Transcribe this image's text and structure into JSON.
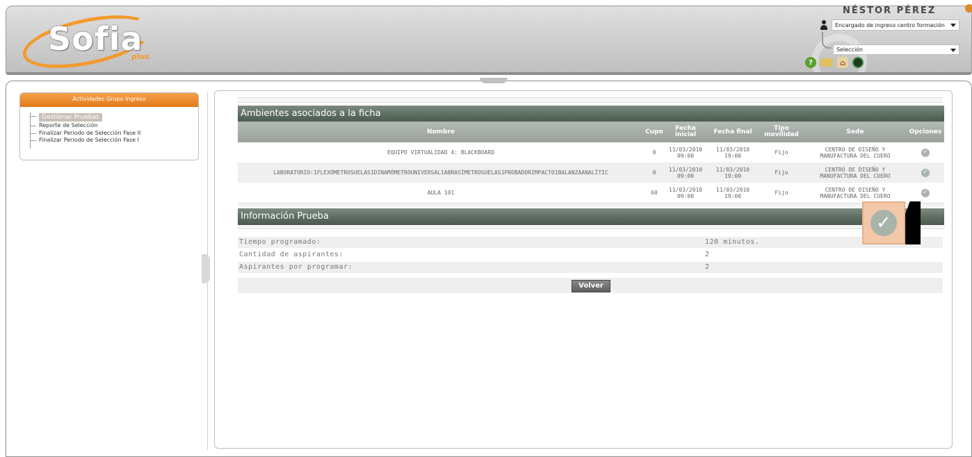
{
  "header": {
    "logo_text": "Sofia",
    "logo_sub": "plus",
    "user_name": "NÉSTOR PÉREZ",
    "role_value": "Encargado de ingreso centro formación",
    "selection_value": "Selección"
  },
  "sidebar": {
    "title": "Actividades Grupo Ingreso",
    "items": [
      {
        "label": "Gestionar Pruebas",
        "active": true
      },
      {
        "label": "Reporte de Selección"
      },
      {
        "label": "Finalizar Periodo de Selección Fase II"
      },
      {
        "label": "Finalizar Periodo de Selección Fase I"
      }
    ]
  },
  "ambientes": {
    "title": "Ambientes asociados a la ficha",
    "columns": {
      "nombre": "Nombre",
      "cupo": "Cupo",
      "fecha_inicial": "Fecha inicial",
      "fecha_final": "Fecha final",
      "tipo_movilidad": "Tipo movilidad",
      "sede": "Sede",
      "opciones": "Opciones"
    },
    "rows": [
      {
        "nombre": "EQUIPO VIRTUALIDAD 4: BLACKBOARD",
        "cupo": "0",
        "fi_fecha": "11/03/2010",
        "fi_hora": "09:00",
        "ff_fecha": "11/03/2010",
        "ff_hora": "19:00",
        "tipo": "Fijo",
        "sede_1": "CENTRO DE DISEÑO Y",
        "sede_2": "MANUFACTURA DEL CUERO"
      },
      {
        "nombre": "LABORATORIO:1FLEXÓMETROSUELAS1DINAMÓMETROUNIVERSAL1ABRASÍMETROSUELAS1PROBADORIMPACTO1BALANZAANALÍTIC",
        "cupo": "0",
        "fi_fecha": "11/03/2010",
        "fi_hora": "09:00",
        "ff_fecha": "11/03/2010",
        "ff_hora": "19:00",
        "tipo": "Fijo",
        "sede_1": "CENTRO DE DISEÑO Y",
        "sede_2": "MANUFACTURA DEL CUERO"
      },
      {
        "nombre": "AULA 101",
        "cupo": "60",
        "fi_fecha": "11/03/2010",
        "fi_hora": "09:00",
        "ff_fecha": "11/03/2010",
        "ff_hora": "19:00",
        "tipo": "Fijo",
        "sede_1": "CENTRO DE DISEÑO Y",
        "sede_2": "MANUFACTURA DEL CUERO"
      }
    ]
  },
  "info": {
    "title": "Información Prueba",
    "rows": [
      {
        "label": "Tiempo programado:",
        "value": "120 minutos."
      },
      {
        "label": "Cantidad de aspirantes:",
        "value": "2"
      },
      {
        "label": "Aspirantes por programar:",
        "value": "2"
      }
    ],
    "volver_label": "Volver"
  },
  "icons": {
    "check": "✓",
    "help": "?",
    "home": "⌂"
  }
}
